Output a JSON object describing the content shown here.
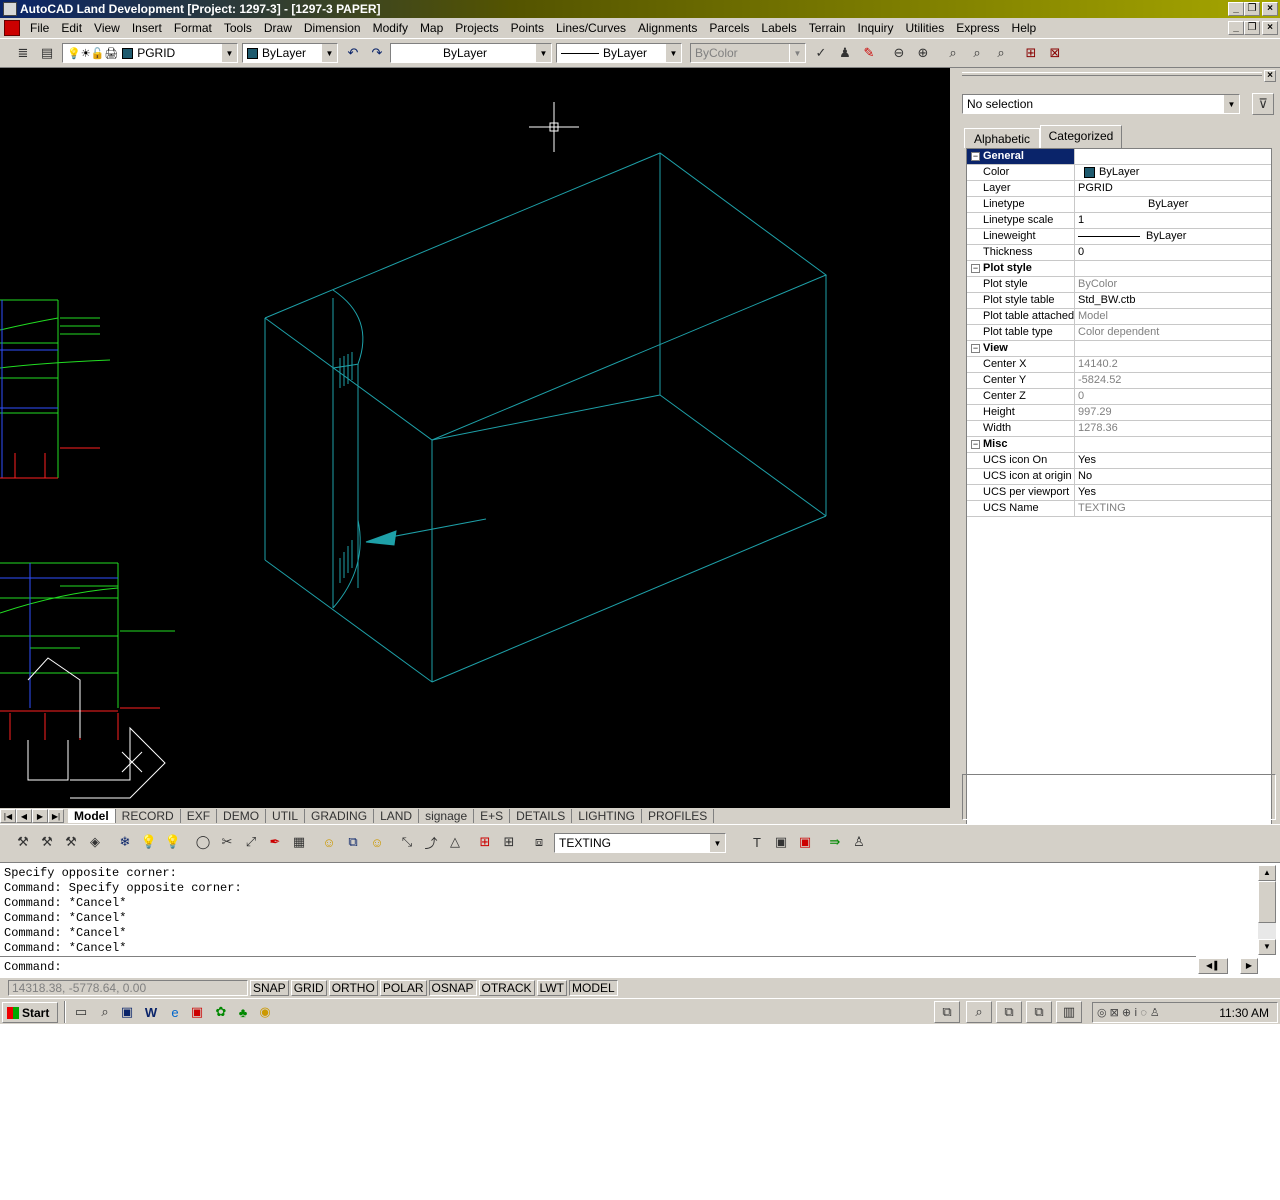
{
  "window": {
    "title": "AutoCAD Land Development [Project: 1297-3] - [1297-3 PAPER]",
    "min_glyph": "_",
    "restore_glyph": "❐",
    "close_glyph": "×"
  },
  "menu": [
    "File",
    "Edit",
    "View",
    "Insert",
    "Format",
    "Tools",
    "Draw",
    "Dimension",
    "Modify",
    "Map",
    "Projects",
    "Points",
    "Lines/Curves",
    "Alignments",
    "Parcels",
    "Labels",
    "Terrain",
    "Inquiry",
    "Utilities",
    "Express",
    "Help"
  ],
  "toolbar": {
    "layer_value": "PGRID",
    "color_value": "ByLayer",
    "linetype_value": "ByLayer",
    "lineweight_value": "ByLayer",
    "plotstyle_value": "ByColor",
    "ucs_value": "TEXTING"
  },
  "colors": {
    "accent": "#0a246a",
    "geometry": "#1ea0a8",
    "swatch": "#1e5a6e"
  },
  "layout_tabs": [
    "Model",
    "RECORD",
    "EXF",
    "DEMO",
    "UTIL",
    "GRADING",
    "LAND",
    "signage",
    "E+S",
    "DETAILS",
    "LIGHTING",
    "PROFILES"
  ],
  "properties": {
    "selection": "No selection",
    "tab_alphabetic": "Alphabetic",
    "tab_categorized": "Categorized",
    "categories": [
      {
        "name": "General",
        "rows": [
          {
            "name": "Color",
            "value": "ByLayer"
          },
          {
            "name": "Layer",
            "value": "PGRID"
          },
          {
            "name": "Linetype",
            "value": "ByLayer"
          },
          {
            "name": "Linetype scale",
            "value": "1"
          },
          {
            "name": "Lineweight",
            "value": "ByLayer"
          },
          {
            "name": "Thickness",
            "value": "0"
          }
        ]
      },
      {
        "name": "Plot style",
        "rows": [
          {
            "name": "Plot style",
            "value": "ByColor"
          },
          {
            "name": "Plot style table",
            "value": "Std_BW.ctb"
          },
          {
            "name": "Plot table attached to",
            "value": "Model"
          },
          {
            "name": "Plot table type",
            "value": "Color dependent"
          }
        ]
      },
      {
        "name": "View",
        "rows": [
          {
            "name": "Center X",
            "value": "14140.2"
          },
          {
            "name": "Center Y",
            "value": "-5824.52"
          },
          {
            "name": "Center Z",
            "value": "0"
          },
          {
            "name": "Height",
            "value": "997.29"
          },
          {
            "name": "Width",
            "value": "1278.36"
          }
        ]
      },
      {
        "name": "Misc",
        "rows": [
          {
            "name": "UCS icon On",
            "value": "Yes"
          },
          {
            "name": "UCS icon at origin",
            "value": "No"
          },
          {
            "name": "UCS per viewport",
            "value": "Yes"
          },
          {
            "name": "UCS Name",
            "value": "TEXTING"
          }
        ]
      }
    ]
  },
  "command": {
    "history": [
      "Specify opposite corner:",
      "Command: Specify opposite corner:",
      "Command: *Cancel*",
      "Command: *Cancel*",
      "Command: *Cancel*",
      "Command: *Cancel*"
    ],
    "prompt": "Command:"
  },
  "status": {
    "coords": "14318.38, -5778.64, 0.00",
    "buttons": [
      "SNAP",
      "GRID",
      "ORTHO",
      "POLAR",
      "OSNAP",
      "OTRACK",
      "LWT",
      "MODEL"
    ]
  },
  "taskbar": {
    "start": "Start",
    "clock": "11:30 AM"
  }
}
